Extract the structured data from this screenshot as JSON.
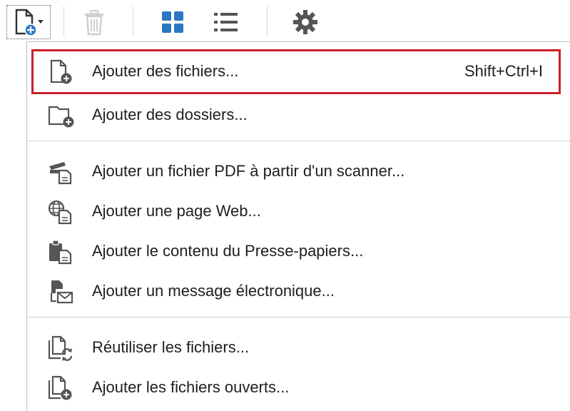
{
  "toolbar": {
    "buttons": [
      {
        "name": "add-files-dropdown",
        "icon": "document-add-icon"
      },
      {
        "name": "delete",
        "icon": "trash-icon"
      },
      {
        "name": "thumbnail-view",
        "icon": "grid-icon"
      },
      {
        "name": "list-view",
        "icon": "list-icon"
      },
      {
        "name": "settings",
        "icon": "gear-icon"
      }
    ],
    "accent_color": "#2b78c2",
    "disabled_color": "#cfcfcf"
  },
  "menu": {
    "items": [
      {
        "label": "Ajouter des fichiers...",
        "shortcut": "Shift+Ctrl+I",
        "icon": "add-file-icon",
        "selected": true
      },
      {
        "label": "Ajouter des dossiers...",
        "icon": "add-folder-icon"
      },
      {
        "label": "Ajouter un fichier PDF à partir d'un scanner...",
        "icon": "scanner-icon"
      },
      {
        "label": "Ajouter une page Web...",
        "icon": "web-page-icon"
      },
      {
        "label": "Ajouter le contenu du Presse-papiers...",
        "icon": "clipboard-icon"
      },
      {
        "label": "Ajouter un message électronique...",
        "icon": "email-icon"
      },
      {
        "label": "Réutiliser les fichiers...",
        "icon": "reuse-files-icon"
      },
      {
        "label": "Ajouter les fichiers ouverts...",
        "icon": "open-files-icon"
      }
    ],
    "highlight_color": "#c8202c"
  }
}
